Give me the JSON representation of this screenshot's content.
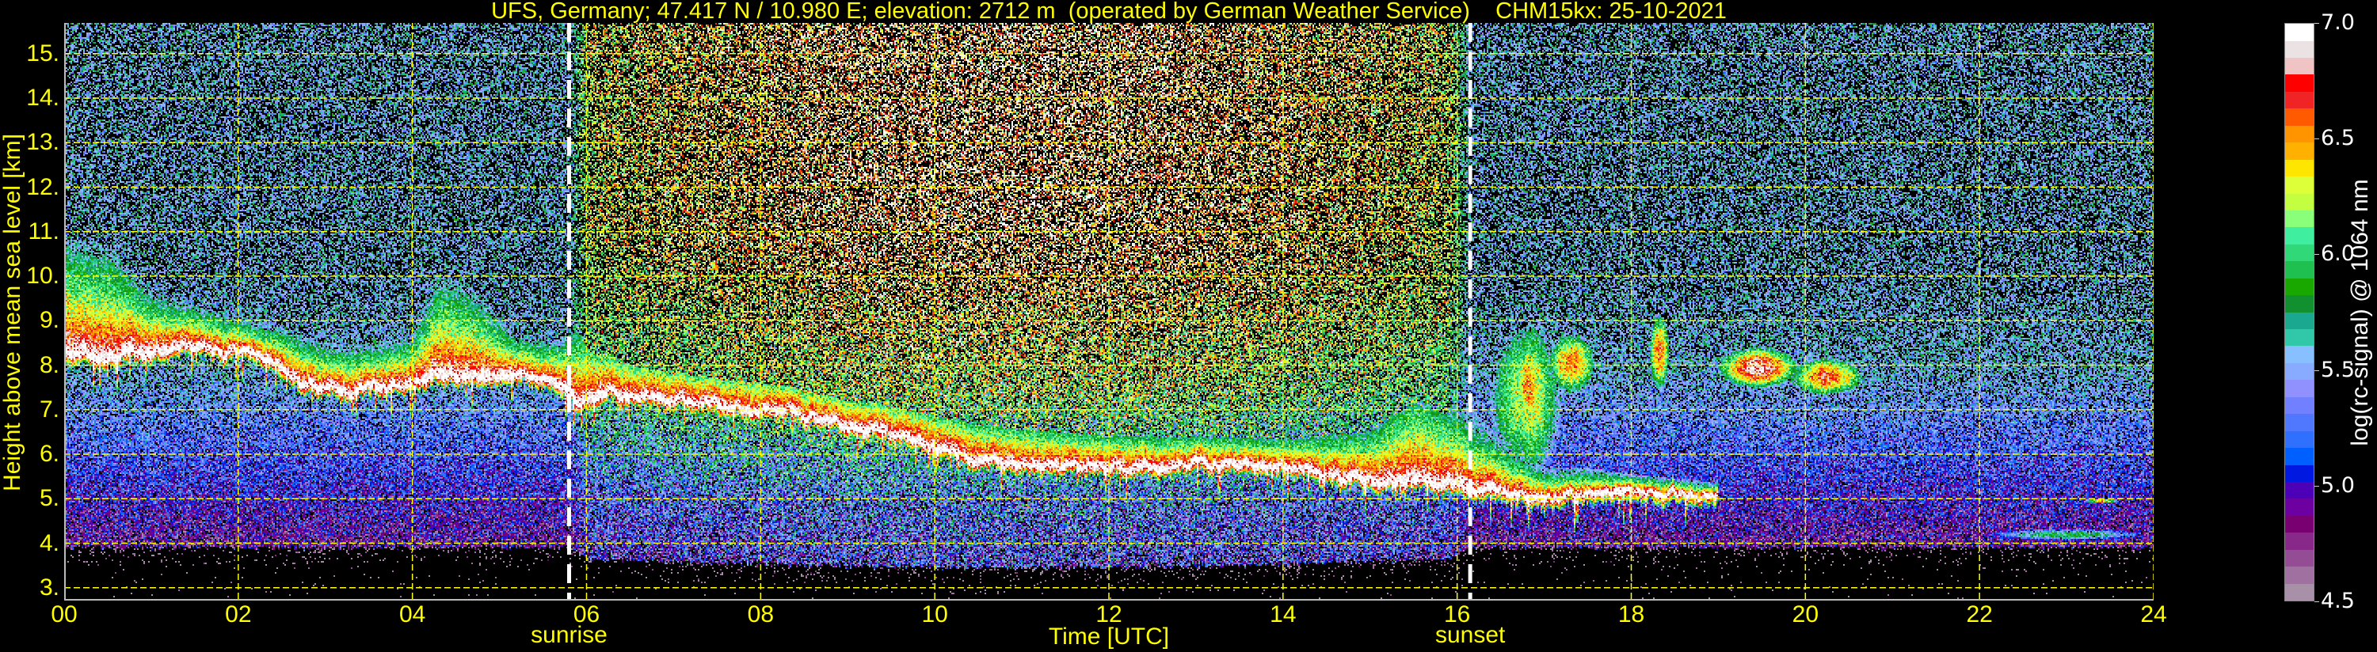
{
  "chart_data": {
    "type": "heatmap",
    "title": "UFS, Germany; 47.417 N / 10.980 E; elevation: 2712 m  (operated by German Weather Service)    CHM15kx: 25-10-2021",
    "xlabel": "Time [UTC]",
    "ylabel": "Height above mean sea level [km]",
    "xlim": [
      0,
      24
    ],
    "ylim": [
      2.712,
      15.69
    ],
    "grid": true,
    "grid_color": "#ffff00",
    "xticks": [
      {
        "value": 0,
        "label": "00"
      },
      {
        "value": 2,
        "label": "02"
      },
      {
        "value": 4,
        "label": "04"
      },
      {
        "value": 6,
        "label": "06"
      },
      {
        "value": 8,
        "label": "08"
      },
      {
        "value": 10,
        "label": "10"
      },
      {
        "value": 12,
        "label": "12"
      },
      {
        "value": 14,
        "label": "14"
      },
      {
        "value": 16,
        "label": "16"
      },
      {
        "value": 18,
        "label": "18"
      },
      {
        "value": 20,
        "label": "20"
      },
      {
        "value": 22,
        "label": "22"
      },
      {
        "value": 24,
        "label": "24"
      }
    ],
    "yticks": [
      {
        "value": 3,
        "label": "3."
      },
      {
        "value": 4,
        "label": "4."
      },
      {
        "value": 5,
        "label": "5."
      },
      {
        "value": 6,
        "label": "6."
      },
      {
        "value": 7,
        "label": "7."
      },
      {
        "value": 8,
        "label": "8."
      },
      {
        "value": 9,
        "label": "9."
      },
      {
        "value": 10,
        "label": "10."
      },
      {
        "value": 11,
        "label": "11."
      },
      {
        "value": 12,
        "label": "12."
      },
      {
        "value": 13,
        "label": "13."
      },
      {
        "value": 14,
        "label": "14."
      },
      {
        "value": 15,
        "label": "15."
      }
    ],
    "annotations": [
      {
        "name": "sunrise",
        "label": "sunrise",
        "time": 5.8
      },
      {
        "name": "sunset",
        "label": "sunset",
        "time": 16.15
      }
    ],
    "colorbar": {
      "label": "log(rc-signal) @ 1064 nm",
      "range": [
        4.5,
        7.0
      ],
      "ticks": [
        {
          "value": 4.5,
          "label": "4.5"
        },
        {
          "value": 5.0,
          "label": "5.0"
        },
        {
          "value": 5.5,
          "label": "5.5"
        },
        {
          "value": 6.0,
          "label": "6.0"
        },
        {
          "value": 6.5,
          "label": "6.5"
        },
        {
          "value": 7.0,
          "label": "7.0"
        }
      ],
      "colors": [
        "#a890a8",
        "#a070a0",
        "#944c94",
        "#882888",
        "#780070",
        "#6c00a0",
        "#4c00b8",
        "#0018e0",
        "#0060ff",
        "#3070ff",
        "#5078ff",
        "#7080ff",
        "#9090ff",
        "#88aaff",
        "#88c0ff",
        "#30c8a8",
        "#1aa890",
        "#129030",
        "#18a800",
        "#20c050",
        "#30d878",
        "#40eea0",
        "#8aff7a",
        "#c3ff40",
        "#dcff3a",
        "#ffe600",
        "#ffb000",
        "#ff9400",
        "#ff5a00",
        "#f02424",
        "#ff0000",
        "#f0c4c4",
        "#ebe3e3",
        "#ffffff"
      ]
    },
    "main_layer": {
      "description_fields": [
        "time_h",
        "core_height_km",
        "top_height_km"
      ],
      "points": [
        [
          0,
          8.3,
          10.8
        ],
        [
          0.5,
          8.2,
          10.6
        ],
        [
          1,
          8.4,
          9.6
        ],
        [
          1.5,
          8.4,
          9.3
        ],
        [
          2,
          8.3,
          9.0
        ],
        [
          2.5,
          8.0,
          8.8
        ],
        [
          3,
          7.5,
          8.4
        ],
        [
          3.5,
          7.5,
          8.4
        ],
        [
          4,
          7.6,
          8.6
        ],
        [
          4.3,
          7.7,
          10.0
        ],
        [
          4.7,
          7.8,
          9.6
        ],
        [
          5.2,
          7.8,
          8.6
        ],
        [
          5.7,
          7.6,
          8.5
        ],
        [
          5.9,
          7.2,
          9.0
        ],
        [
          6.5,
          7.4,
          8.4
        ],
        [
          7,
          7.2,
          8.2
        ],
        [
          8,
          7.0,
          8.0
        ],
        [
          9,
          6.7,
          7.6
        ],
        [
          10,
          6.3,
          7.2
        ],
        [
          10.5,
          6.0,
          7.0
        ],
        [
          11,
          5.8,
          6.8
        ],
        [
          12,
          5.7,
          6.6
        ],
        [
          13,
          5.8,
          6.5
        ],
        [
          14,
          5.7,
          6.4
        ],
        [
          15,
          5.4,
          6.6
        ],
        [
          15.5,
          5.4,
          7.6
        ],
        [
          16,
          5.3,
          7.0
        ],
        [
          16.5,
          5.2,
          6.2
        ],
        [
          17,
          5.0,
          5.6
        ],
        [
          17.5,
          5.2,
          5.6
        ],
        [
          18,
          5.2,
          5.5
        ],
        [
          18.5,
          5.15,
          5.4
        ],
        [
          19,
          5.1,
          5.3
        ]
      ]
    },
    "other_clouds": {
      "description_fields": [
        "start_h",
        "end_h",
        "base_km",
        "top_km",
        "peak_log_signal"
      ],
      "items": [
        [
          16.3,
          17.3,
          5.2,
          9.4,
          6.4
        ],
        [
          16.6,
          17.0,
          6.3,
          8.8,
          6.6
        ],
        [
          17.0,
          17.6,
          7.3,
          8.8,
          6.7
        ],
        [
          18.2,
          18.45,
          7.4,
          9.2,
          6.8
        ],
        [
          19.0,
          19.9,
          7.5,
          8.4,
          7.0
        ],
        [
          19.8,
          20.7,
          7.3,
          8.2,
          6.8
        ],
        [
          22.0,
          24.0,
          4.05,
          4.35,
          6.0
        ],
        [
          23.2,
          23.6,
          4.9,
          5.0,
          6.6
        ]
      ]
    }
  }
}
